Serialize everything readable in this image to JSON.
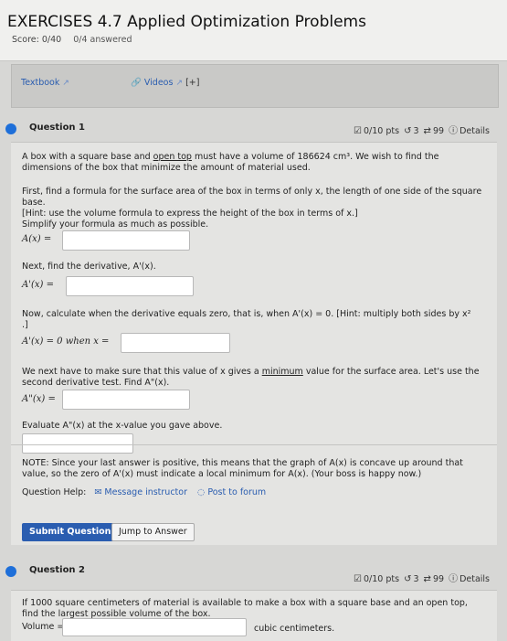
{
  "header": {
    "title": "EXERCISES 4.7 Applied Optimization Problems",
    "score_label": "Score: 0/40",
    "answered": "0/4 answered"
  },
  "resources": {
    "textbook": "Textbook",
    "videos": "Videos",
    "videos_expand": "[+]"
  },
  "question1": {
    "title": "Question 1",
    "points": "0/10 pts",
    "retries": "3",
    "attempts": "99",
    "details": "Details",
    "intro_before": "A box with a square base and ",
    "intro_link": "open top",
    "intro_after": " must have a volume of 186624 cm³. We wish to find the dimensions of the box that minimize the amount of material used.",
    "step1": "First, find a formula for the surface area of the box in terms of only x, the length of one side of the square base.",
    "hint1": "[Hint: use the volume formula to express the height of the box in terms of x.]",
    "simplify": "Simplify your formula as much as possible.",
    "label_A": "A(x) =",
    "step2": "Next, find the derivative, A'(x).",
    "label_A1": "A'(x) =",
    "step3": "Now, calculate when the derivative equals zero, that is, when A'(x) = 0. [Hint: multiply both sides by x²",
    "step3_end": ".]",
    "label_zero": "A'(x) = 0 when x =",
    "step4_before": "We next have to make sure that this value of x gives a ",
    "step4_link": "minimum",
    "step4_after": " value for the surface area. Let's use the second derivative test. Find A\"(x).",
    "label_A2": "A\"(x) =",
    "step5": "Evaluate A\"(x) at the x-value you gave above.",
    "note": "NOTE: Since your last answer is positive, this means that the graph of A(x) is concave up around that value, so the zero of A'(x) must indicate a local minimum for A(x). (Your boss is happy now.)",
    "help_label": "Question Help:",
    "message_instructor": "Message instructor",
    "post_forum": "Post to forum",
    "submit": "Submit Question",
    "jump": "Jump to Answer"
  },
  "question2": {
    "title": "Question 2",
    "points": "0/10 pts",
    "retries": "3",
    "attempts": "99",
    "details": "Details",
    "text": "If 1000 square centimeters of material is available to make a box with a square base and an open top, find the largest possible volume of the box.",
    "volume_label": "Volume =",
    "unit": "cubic centimeters."
  }
}
